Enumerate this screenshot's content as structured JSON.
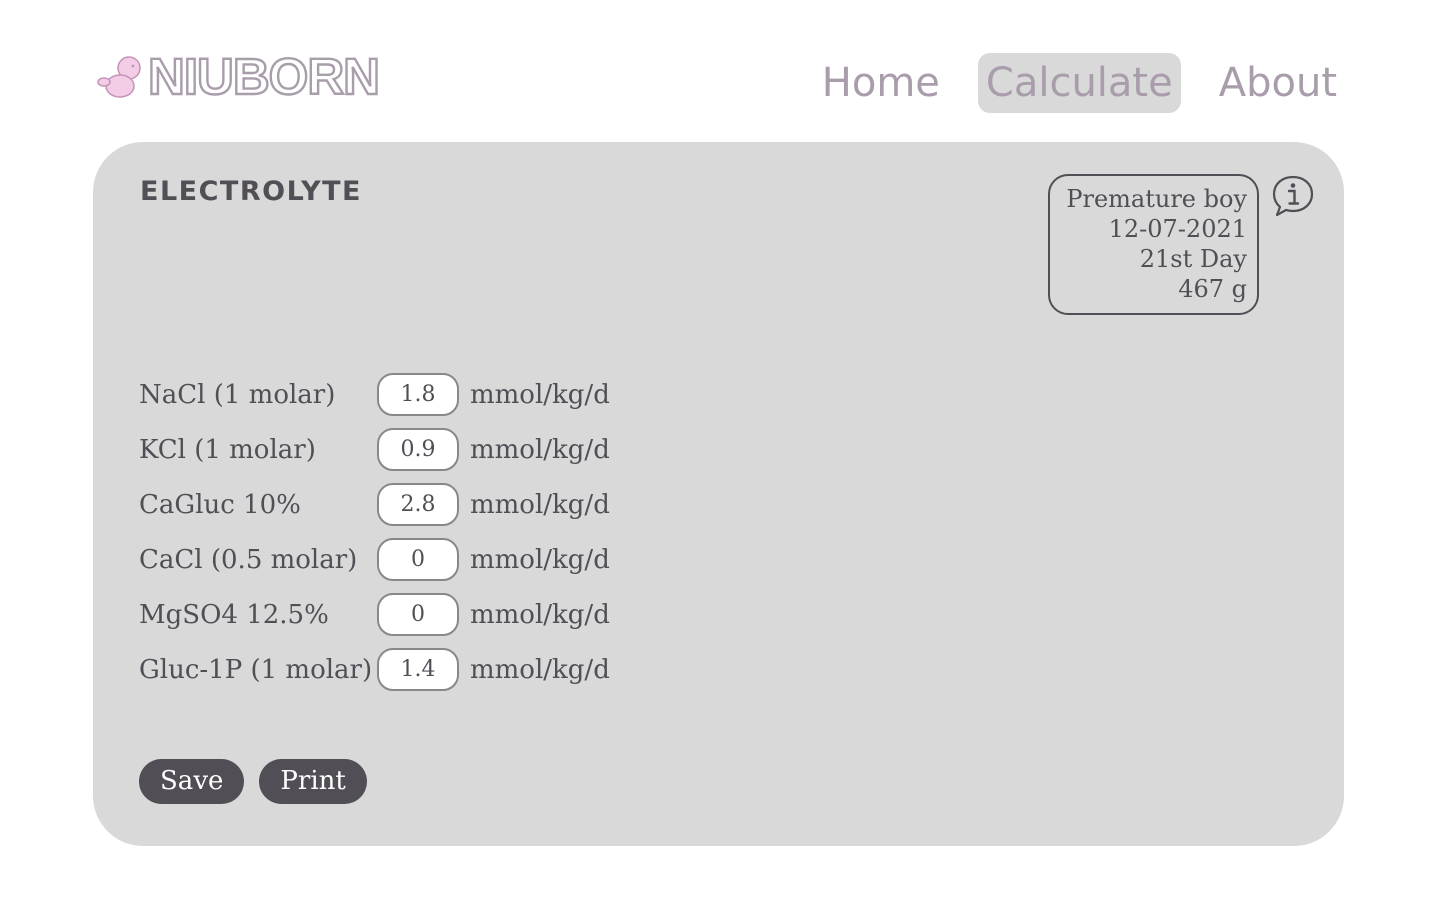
{
  "brand": {
    "name": "NIUBORN",
    "color": "#a99dac",
    "baby_color": "#f3cce6"
  },
  "nav": [
    {
      "label": "Home",
      "active": false
    },
    {
      "label": "Calculate",
      "active": true
    },
    {
      "label": "About",
      "active": false
    }
  ],
  "card": {
    "title": "ELECTROLYTE",
    "patient": {
      "type": "Premature boy",
      "date": "12-07-2021",
      "day": "21st Day",
      "weight": "467 g"
    },
    "info_icon": "info-speech-bubble-icon",
    "rows": [
      {
        "label": "NaCl (1 molar)",
        "value": "1.8",
        "unit": "mmol/kg/d"
      },
      {
        "label": "KCl (1 molar)",
        "value": "0.9",
        "unit": "mmol/kg/d"
      },
      {
        "label": "CaGluc 10%",
        "value": "2.8",
        "unit": "mmol/kg/d"
      },
      {
        "label": "CaCl (0.5 molar)",
        "value": "0",
        "unit": "mmol/kg/d"
      },
      {
        "label": "MgSO4 12.5%",
        "value": "0",
        "unit": "mmol/kg/d"
      },
      {
        "label": "Gluc-1P (1 molar)",
        "value": "1.4",
        "unit": "mmol/kg/d"
      }
    ],
    "buttons": {
      "save": "Save",
      "print": "Print"
    }
  },
  "colors": {
    "card_bg": "#d9d9d9",
    "text_dark": "#524e56",
    "accent": "#a99dac"
  }
}
